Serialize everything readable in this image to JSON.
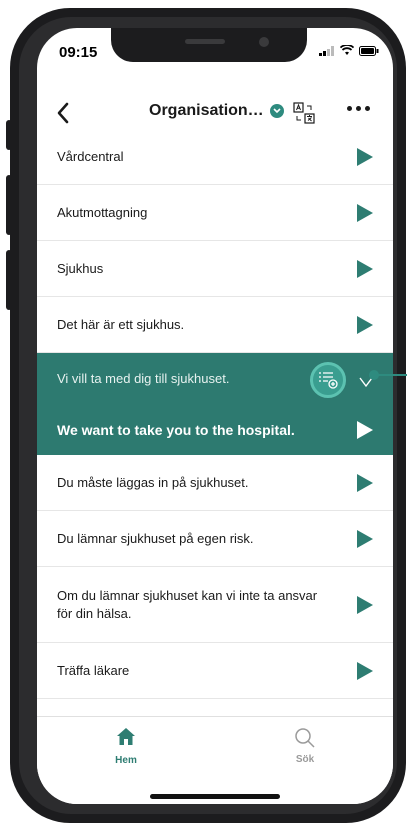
{
  "status_bar": {
    "time": "09:15"
  },
  "header": {
    "back_icon": "chevron-left-icon",
    "title": "Organisation…",
    "translate_icon": "translate-icon",
    "more_icon": "more-horizontal-icon"
  },
  "list": {
    "items": [
      {
        "text": "Vårdcentral"
      },
      {
        "text": "Akutmottagning"
      },
      {
        "text": "Sjukhus"
      },
      {
        "text": "Det här är ett sjukhus."
      }
    ],
    "highlight": {
      "original": "Vi vill ta med dig till sjukhuset.",
      "translation": "We want to take you to the hospital."
    },
    "items_after": [
      {
        "text": "Du måste läggas in på sjukhuset."
      },
      {
        "text": "Du lämnar sjukhuset på egen risk."
      },
      {
        "text": "Om du lämnar sjukhuset kan vi inte ta ansvar för din hälsa."
      },
      {
        "text": "Träffa läkare"
      }
    ]
  },
  "tabbar": {
    "home_label": "Hem",
    "search_label": "Sök"
  },
  "colors": {
    "accent": "#2e7d72",
    "highlight_bg": "#2d7a70",
    "highlight_ring": "#5cc2b1"
  }
}
